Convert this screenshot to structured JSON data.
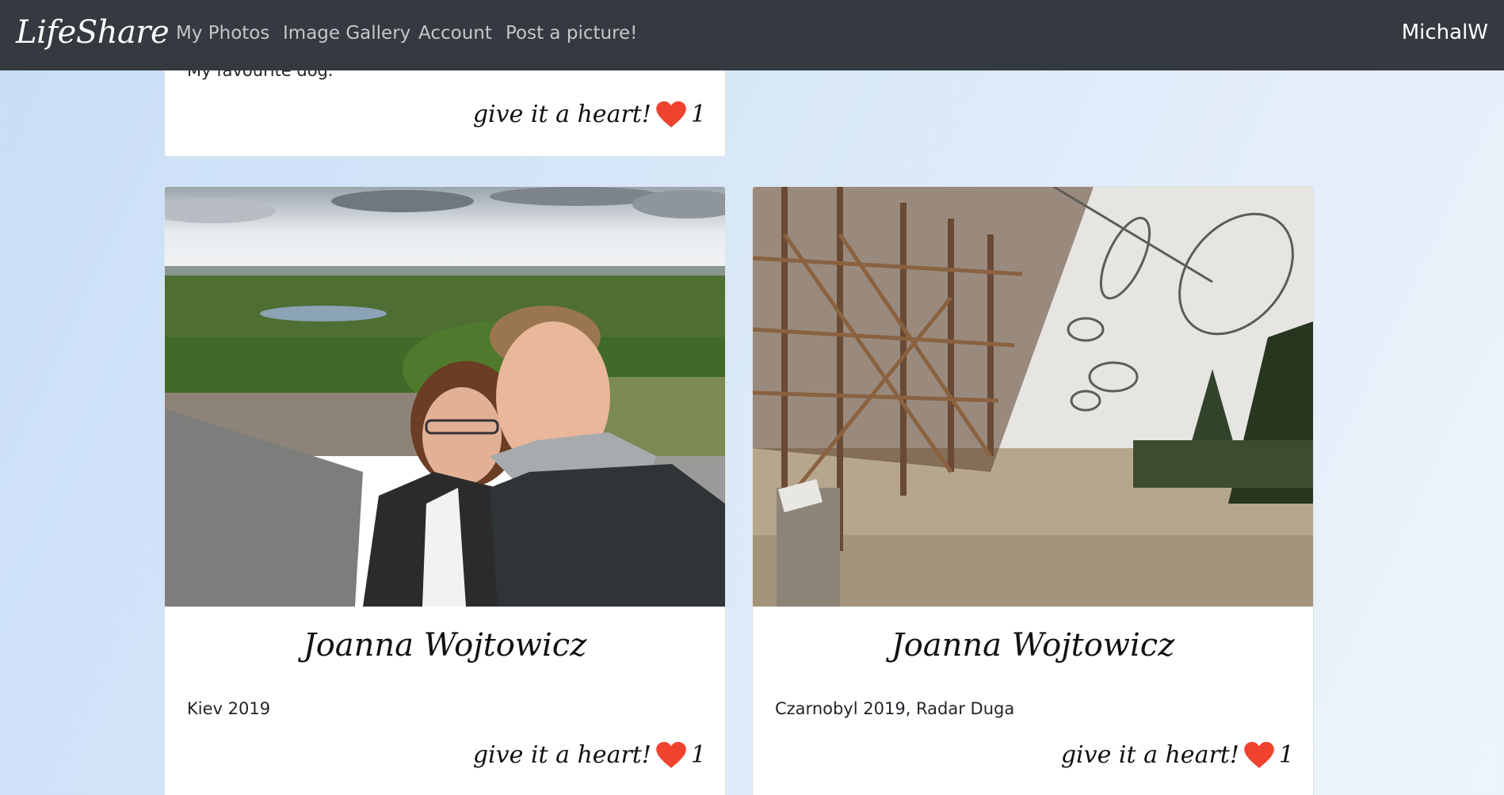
{
  "navbar": {
    "brand": "LifeShare",
    "links": [
      "My Photos",
      "Image Gallery",
      "Account",
      "Post a picture!"
    ],
    "user": "MichalW"
  },
  "posts": [
    {
      "description": "My favourite dog.",
      "heart_label": "give it a heart!",
      "hearts": "1"
    },
    {
      "author": "Joanna Wojtowicz",
      "description": "Kiev 2019",
      "heart_label": "give it a heart!",
      "hearts": "1"
    },
    {
      "author": "Joanna Wojtowicz",
      "description": "Czarnobyl 2019, Radar Duga",
      "heart_label": "give it a heart!",
      "hearts": "1"
    }
  ],
  "colors": {
    "navbar": "#343a40",
    "heart": "#f0432f"
  }
}
